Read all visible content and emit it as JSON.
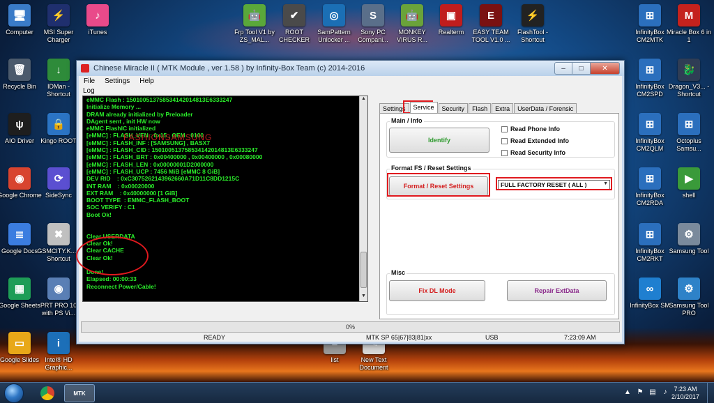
{
  "desktop_icons": [
    {
      "label": "Computer",
      "glyph": "🖥",
      "color": "#3a7bc8"
    },
    {
      "label": "MSI Super Charger",
      "glyph": "⚡",
      "color": "#1f2f6e"
    },
    {
      "label": "iTunes",
      "glyph": "♪",
      "color": "#e94a8a"
    },
    {
      "label": "Frp Tool V1 by ZS_MAL...",
      "glyph": "🤖",
      "color": "#5aa83a"
    },
    {
      "label": "ROOT CHECKER",
      "glyph": "✔",
      "color": "#4a4a4a"
    },
    {
      "label": "SamPattern Unlocker ...",
      "glyph": "◎",
      "color": "#1b6fb5"
    },
    {
      "label": "Sony PC Compani...",
      "glyph": "S",
      "color": "#5a6f8a"
    },
    {
      "label": "MONKEY VIRUS R...",
      "glyph": "🤖",
      "color": "#6aa33a"
    },
    {
      "label": "Realterm",
      "glyph": "▣",
      "color": "#c01d1d"
    },
    {
      "label": "EASY TEAM TOOL V1.0 ...",
      "glyph": "E",
      "color": "#7a1111"
    },
    {
      "label": "FlashTool - Shortcut",
      "glyph": "⚡",
      "color": "#222222"
    },
    {
      "label": "InfinityBox CM2MTK",
      "glyph": "⊞",
      "color": "#2b6fbd"
    },
    {
      "label": "Miracle Box 6 in 1",
      "glyph": "M",
      "color": "#c4221d"
    },
    {
      "label": "Recycle Bin",
      "glyph": "🗑",
      "color": "#4b5a6c"
    },
    {
      "label": "IDMan - Shortcut",
      "glyph": "↓",
      "color": "#2e8b3a"
    },
    {
      "label": "InfinityBox CM2SPD",
      "glyph": "⊞",
      "color": "#2b6fbd"
    },
    {
      "label": "Dragon_V3... - Shortcut",
      "glyph": "🐉",
      "color": "#2f3d55"
    },
    {
      "label": "AIO Driver",
      "glyph": "ψ",
      "color": "#1e1e1e"
    },
    {
      "label": "Kingo ROOT",
      "glyph": "🔒",
      "color": "#2b74c4"
    },
    {
      "label": "InfinityBox CM2QLM",
      "glyph": "⊞",
      "color": "#2b6fbd"
    },
    {
      "label": "Octoplus Samsu...",
      "glyph": "⊞",
      "color": "#2b6fbd"
    },
    {
      "label": "Google Chrome",
      "glyph": "◉",
      "color": "#d8442f"
    },
    {
      "label": "SideSync",
      "glyph": "⟳",
      "color": "#5b4fd1"
    },
    {
      "label": "InfinityBox CM2RDA",
      "glyph": "⊞",
      "color": "#2b6fbd"
    },
    {
      "label": "shell",
      "glyph": "▶",
      "color": "#3a9a3a"
    },
    {
      "label": "Google Docs",
      "glyph": "≣",
      "color": "#3b7de0"
    },
    {
      "label": "GSMCITY.K... - Shortcut",
      "glyph": "✖",
      "color": "#c0c0c0"
    },
    {
      "label": "InfinityBox CM2RKT",
      "glyph": "⊞",
      "color": "#2b6fbd"
    },
    {
      "label": "Samsung Tool",
      "glyph": "⚙",
      "color": "#7a8a9c"
    },
    {
      "label": "Google Sheets",
      "glyph": "▦",
      "color": "#1e9d57"
    },
    {
      "label": "PRT PRO 10 with PS Vi...",
      "glyph": "◉",
      "color": "#5a7fb5"
    },
    {
      "label": "InfinityBox SM",
      "glyph": "∞",
      "color": "#1f7fd0"
    },
    {
      "label": "Samsung Tool PRO",
      "glyph": "⚙",
      "color": "#2e82c8"
    },
    {
      "label": "Google Slides",
      "glyph": "▭",
      "color": "#e8a818"
    },
    {
      "label": "Intel® HD Graphic...",
      "glyph": "i",
      "color": "#1c6fb8"
    },
    {
      "label": "list",
      "glyph": "≡",
      "color": "#9a9a9a"
    },
    {
      "label": "New Text Document",
      "glyph": "✎",
      "color": "#d8d8d8"
    }
  ],
  "window": {
    "title": "Chinese Miracle II ( MTK Module , ver 1.58 ) by Infinity-Box Team (c) 2014-2016",
    "minimize": "–",
    "maximize": "□",
    "close": "✕"
  },
  "menu": [
    "File",
    "Settings",
    "Help"
  ],
  "log": {
    "label": "Log",
    "overlay_text": "FASHIONSAMSUNG",
    "lines_top": [
      "eMMC Flash : 150100513758534142014813E6333247",
      "Initialize Memory ...",
      "DRAM already initialized by Preloader",
      "DAgent sent , init HW now",
      "eMMC FlashIC initialized",
      "[eMMC] : FLASH_VEN : 0x15 , OEM : 0100",
      "[eMMC] : FLASH_INF : [SAMSUNG] , BASX7",
      "[eMMC] : FLASH_CID : 150100513758534142014813E6333247",
      "[eMMC] : FLASH_BRT : 0x00400000 , 0x00400000 , 0x00080000",
      "[eMMC] : FLASH_LEN : 0x00000001D2000000",
      "[eMMC] : FLASH_UCP : 7456 MiB [eMMC 8 GiB]",
      "DEV RID    : 0xC3075262143962660A71D11C8DD1215C",
      "INT RAM    : 0x00020000",
      "EXT RAM    : 0x40000000 [1 GiB]",
      "BOOT TYPE  : EMMC_FLASH_BOOT",
      "SOC VERIFY : C1",
      "Boot Ok!"
    ],
    "lines_mid": [
      "Clear USERDATA",
      "Clear Ok!",
      "Clear CACHE",
      "Clear Ok!"
    ],
    "lines_end": [
      "Done!",
      "Elapsed: 00:00:33",
      "Reconnect Power/Cable!"
    ]
  },
  "tabs": [
    "Settings",
    "Service",
    "Security",
    "Flash",
    "Extra",
    "UserData / Forensic"
  ],
  "active_tab": "Service",
  "main_info": {
    "title": "Main / Info",
    "identify": "Identify",
    "checkboxes": [
      "Read Phone Info",
      "Read Extended Info",
      "Read Security Info"
    ]
  },
  "format": {
    "title": "Format FS / Reset Settings",
    "button": "Format / Reset Settings",
    "selected": "FULL FACTORY RESET ( ALL )"
  },
  "misc": {
    "title": "Misc",
    "fix_dl": "Fix DL Mode",
    "repair": "Repair ExtData"
  },
  "progress": "0%",
  "status": {
    "state": "READY",
    "device": "MTK SP 65|67|83|81|xx",
    "port": "USB",
    "time": "7:23:09 AM"
  },
  "taskbar": {
    "clock_time": "7:23 AM",
    "clock_date": "2/10/2017",
    "mtk_label": "MTK"
  },
  "colors": {
    "log_text": "#2bee2b",
    "identify_text": "#2e9a2e",
    "format_text": "#d42020",
    "fix_dl_text": "#d42020",
    "repair_text": "#8a2a8a",
    "highlight": "#e0191e"
  }
}
